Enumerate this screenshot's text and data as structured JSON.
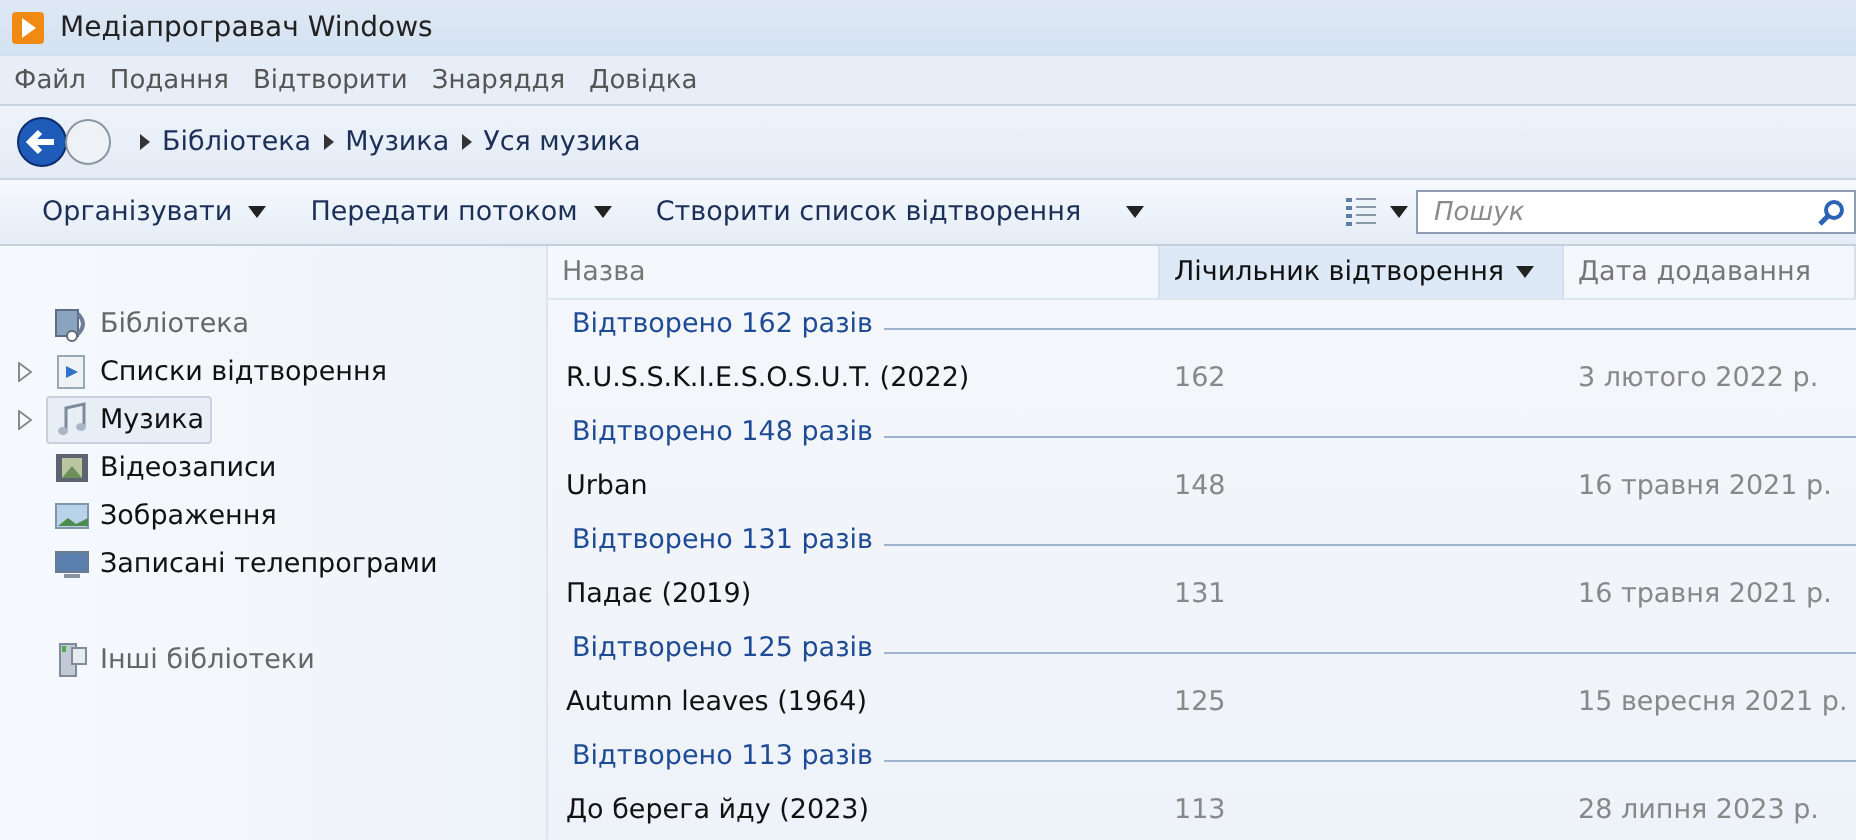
{
  "window": {
    "title": "Медіапрогравач Windows"
  },
  "menu": [
    "Файл",
    "Подання",
    "Відтворити",
    "Знаряддя",
    "Довідка"
  ],
  "breadcrumb": [
    "Бібліотека",
    "Музика",
    "Уся музика"
  ],
  "toolbar": {
    "buttons": [
      "Організувати",
      "Передати потоком",
      "Створити список відтворення"
    ],
    "search": {
      "placeholder": "Пошук"
    }
  },
  "sidebar": {
    "items": [
      {
        "label": "Бібліотека",
        "kind": "library",
        "has_children": false,
        "selected": false,
        "dim": true
      },
      {
        "label": "Списки відтворення",
        "kind": "playlist",
        "has_children": true,
        "selected": false,
        "dim": false
      },
      {
        "label": "Музика",
        "kind": "music",
        "has_children": true,
        "selected": true,
        "dim": false
      },
      {
        "label": "Відеозаписи",
        "kind": "video",
        "has_children": false,
        "selected": false,
        "dim": false
      },
      {
        "label": "Зображення",
        "kind": "picture",
        "has_children": false,
        "selected": false,
        "dim": false
      },
      {
        "label": "Записані телепрограми",
        "kind": "tv",
        "has_children": false,
        "selected": false,
        "dim": false
      },
      {
        "label": "Інші бібліотеки",
        "kind": "other",
        "has_children": false,
        "selected": false,
        "dim": true
      }
    ]
  },
  "table": {
    "columns": [
      {
        "label": "Назва",
        "sorted": false
      },
      {
        "label": "Лічильник відтворення",
        "sorted": true
      },
      {
        "label": "Дата додавання",
        "sorted": false
      }
    ],
    "groups": [
      {
        "header": "Відтворено 162 разів",
        "rows": [
          [
            "R.U.S.S.K.I.E.S.O.S.U.T. (2022)",
            "162",
            "3 лютого 2022 р."
          ]
        ]
      },
      {
        "header": "Відтворено 148 разів",
        "rows": [
          [
            "Urban",
            "148",
            "16 травня 2021 р."
          ]
        ]
      },
      {
        "header": "Відтворено 131 разів",
        "rows": [
          [
            "Падає (2019)",
            "131",
            "16 травня 2021 р."
          ]
        ]
      },
      {
        "header": "Відтворено 125 разів",
        "rows": [
          [
            "Autumn leaves (1964)",
            "125",
            "15 вересня 2021 р."
          ]
        ]
      },
      {
        "header": "Відтворено 113 разів",
        "rows": [
          [
            "До берега йду (2023)",
            "113",
            "28 липня 2023 р."
          ]
        ]
      }
    ]
  }
}
